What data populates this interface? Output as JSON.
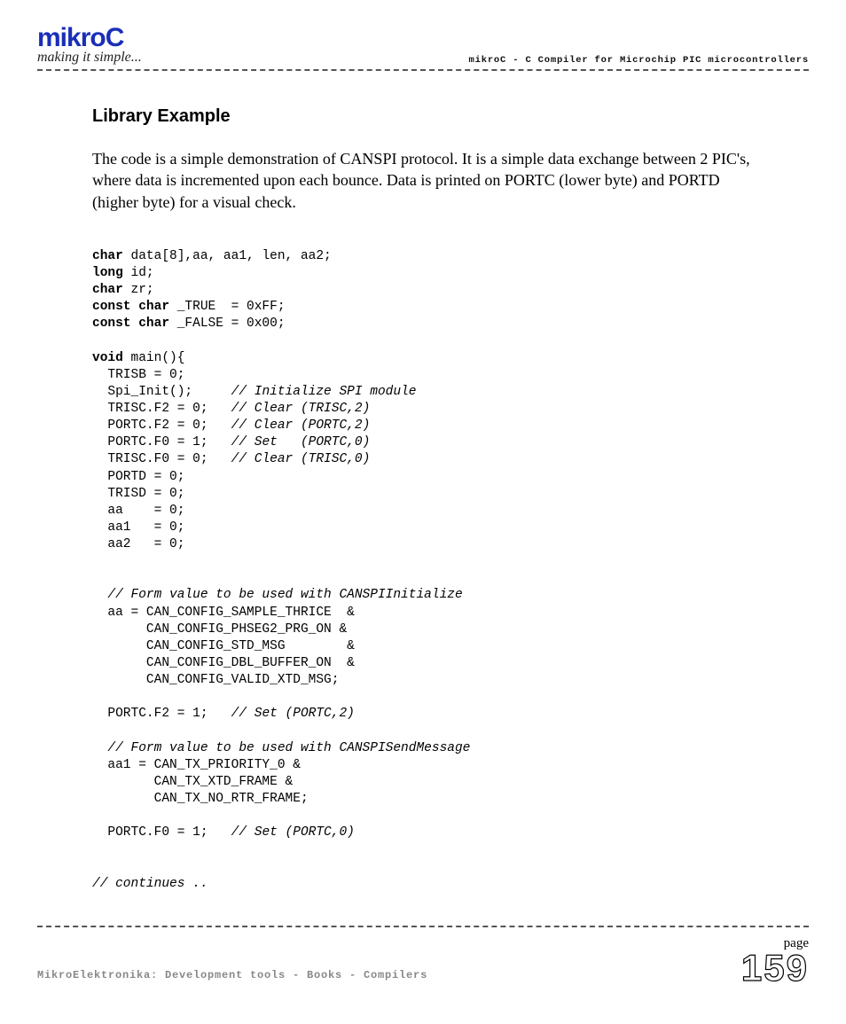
{
  "header": {
    "logo": "mikroC",
    "tagline": "making it simple...",
    "right_brand": "mikroC",
    "right_text": " - C Compiler for Microchip PIC microcontrollers"
  },
  "section_title": "Library Example",
  "intro": "The code is a simple demonstration of CANSPI protocol. It is a simple data exchange between 2 PIC's, where data is incremented upon each bounce. Data is printed on PORTC (lower byte) and PORTD (higher byte) for a visual check.",
  "code_lines": [
    {
      "pre": "",
      "kw": "char",
      "txt": " data[8],aa, aa1, len, aa2;"
    },
    {
      "pre": "",
      "kw": "long",
      "txt": " id;"
    },
    {
      "pre": "",
      "kw": "char",
      "txt": " zr;"
    },
    {
      "pre": "",
      "kw": "const char",
      "txt": " _TRUE  = 0xFF;"
    },
    {
      "pre": "",
      "kw": "const char",
      "txt": " _FALSE = 0x00;"
    },
    {
      "blank": true
    },
    {
      "pre": "",
      "kw": "void",
      "txt": " main(){"
    },
    {
      "pre": "  ",
      "txt": "TRISB = 0;"
    },
    {
      "pre": "  ",
      "txt": "Spi_Init();     ",
      "cm": "// Initialize SPI module"
    },
    {
      "pre": "  ",
      "txt": "TRISC.F2 = 0;   ",
      "cm": "// Clear (TRISC,2)"
    },
    {
      "pre": "  ",
      "txt": "PORTC.F2 = 0;   ",
      "cm": "// Clear (PORTC,2)"
    },
    {
      "pre": "  ",
      "txt": "PORTC.F0 = 1;   ",
      "cm": "// Set   (PORTC,0)"
    },
    {
      "pre": "  ",
      "txt": "TRISC.F0 = 0;   ",
      "cm": "// Clear (TRISC,0)"
    },
    {
      "pre": "  ",
      "txt": "PORTD = 0;"
    },
    {
      "pre": "  ",
      "txt": "TRISD = 0;"
    },
    {
      "pre": "  ",
      "txt": "aa    = 0;"
    },
    {
      "pre": "  ",
      "txt": "aa1   = 0;"
    },
    {
      "pre": "  ",
      "txt": "aa2   = 0;"
    },
    {
      "blank": true
    },
    {
      "blank": true
    },
    {
      "pre": "  ",
      "cm": "// Form value to be used with CANSPIInitialize"
    },
    {
      "pre": "  ",
      "txt": "aa = CAN_CONFIG_SAMPLE_THRICE  &"
    },
    {
      "pre": "       ",
      "txt": "CAN_CONFIG_PHSEG2_PRG_ON &"
    },
    {
      "pre": "       ",
      "txt": "CAN_CONFIG_STD_MSG        &"
    },
    {
      "pre": "       ",
      "txt": "CAN_CONFIG_DBL_BUFFER_ON  &"
    },
    {
      "pre": "       ",
      "txt": "CAN_CONFIG_VALID_XTD_MSG;"
    },
    {
      "blank": true
    },
    {
      "pre": "  ",
      "txt": "PORTC.F2 = 1;   ",
      "cm": "// Set (PORTC,2)"
    },
    {
      "blank": true
    },
    {
      "pre": "  ",
      "cm": "// Form value to be used with CANSPISendMessage"
    },
    {
      "pre": "  ",
      "txt": "aa1 = CAN_TX_PRIORITY_0 &"
    },
    {
      "pre": "        ",
      "txt": "CAN_TX_XTD_FRAME &"
    },
    {
      "pre": "        ",
      "txt": "CAN_TX_NO_RTR_FRAME;"
    },
    {
      "blank": true
    },
    {
      "pre": "  ",
      "txt": "PORTC.F0 = 1;   ",
      "cm": "// Set (PORTC,0)"
    },
    {
      "blank": true
    },
    {
      "blank": true
    },
    {
      "pre": "",
      "cm": "// continues .."
    }
  ],
  "footer": {
    "left": "MikroElektronika: Development tools - Books - Compilers",
    "page_label": "page",
    "page_number": "159"
  }
}
